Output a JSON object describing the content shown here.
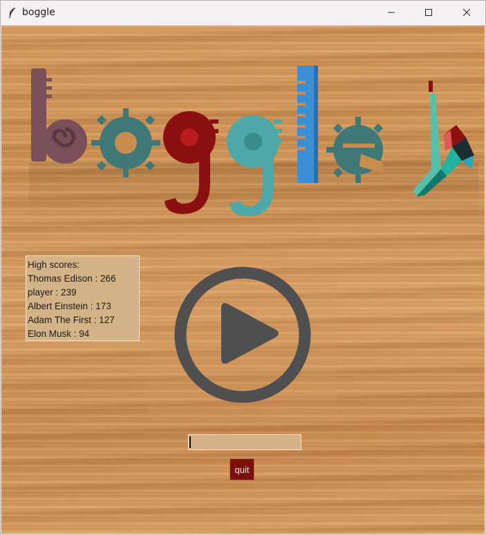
{
  "window": {
    "title": "boggle"
  },
  "high_scores": {
    "heading": "High scores:",
    "entries": [
      "Thomas Edison : 266",
      "player : 239",
      "Albert Einstein : 173",
      "Adam The First : 127",
      "Elon Musk : 94"
    ]
  },
  "entry": {
    "value": ""
  },
  "quit_button": {
    "label": "quit"
  },
  "colors": {
    "logo_b": "#7a4f59",
    "logo_o": "#3f7876",
    "logo_g1": "#8a1010",
    "logo_g2": "#4ea8a8",
    "logo_l": "#3a8fd6",
    "logo_e": "#3f7876",
    "play_icon": "#4f4f4f",
    "button_bg": "#7d0f0f",
    "panel_bg": "#d3b387"
  }
}
